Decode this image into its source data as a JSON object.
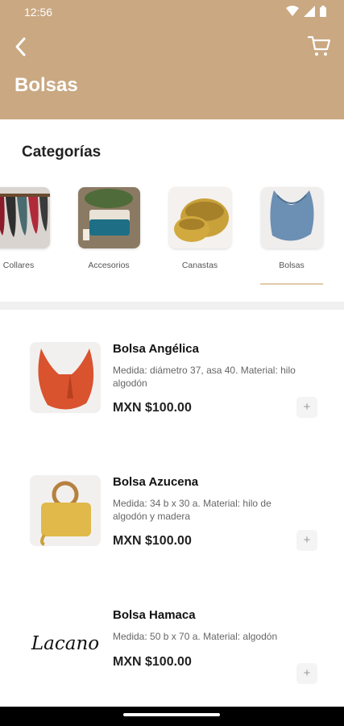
{
  "status_bar": {
    "time": "12:56"
  },
  "header": {
    "title": "Bolsas",
    "accent_color": "#c9a882"
  },
  "categories": {
    "title": "Categorías",
    "items": [
      {
        "label": "Collares",
        "icon": "necklaces-thumbnail"
      },
      {
        "label": "Accesorios",
        "icon": "accessories-thumbnail"
      },
      {
        "label": "Canastas",
        "icon": "baskets-thumbnail"
      },
      {
        "label": "Bolsas",
        "icon": "bags-thumbnail",
        "selected": true
      }
    ]
  },
  "products": [
    {
      "name": "Bolsa Angélica",
      "description": "Medida: diámetro 37, asa 40. Material: hilo algodón",
      "price": "MXN $100.00",
      "add_label": "+"
    },
    {
      "name": "Bolsa Azucena",
      "description": "Medida: 34 b x 30 a. Material: hilo de algodón y madera",
      "price": "MXN $100.00",
      "add_label": "+"
    },
    {
      "name": "Bolsa Hamaca",
      "description": "Medida: 50 b x 70 a. Material: algodón",
      "price": "MXN $100.00",
      "add_label": "+",
      "logo_text": "Lacano"
    }
  ]
}
